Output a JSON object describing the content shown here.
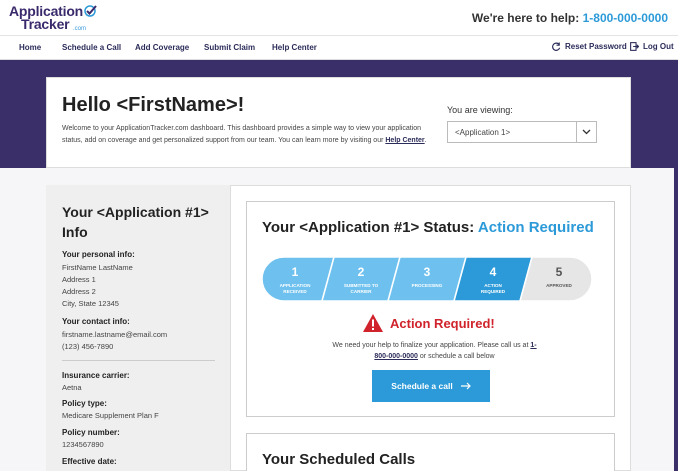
{
  "header": {
    "logo_line1": "Application",
    "logo_line2": "Tracker",
    "logo_suffix": ".com",
    "help_text": "We're here to help:",
    "help_phone": "1-800-000-0000"
  },
  "nav": {
    "items": [
      {
        "label": "Home"
      },
      {
        "label": "Schedule a Call"
      },
      {
        "label": "Add Coverage"
      },
      {
        "label": "Submit Claim"
      },
      {
        "label": "Help Center"
      }
    ],
    "reset_password": "Reset Password",
    "logout": "Log Out"
  },
  "hello": {
    "title": "Hello <FirstName>!",
    "text": "Welcome to your ApplicationTracker.com dashboard. This dashboard provides a simple way to view your application status, add on coverage and get personalized support from our team. You can learn more by visiting our",
    "link": "Help Center",
    "text_end": ".",
    "viewing_label": "You are viewing:",
    "selected_application": "<Application 1>"
  },
  "info": {
    "title": "Your <Application #1> Info",
    "personal_label": "Your personal info:",
    "personal_lines": [
      "FirstName LastName",
      "Address 1",
      "Address 2",
      "City, State 12345"
    ],
    "contact_label": "Your contact info:",
    "contact_lines": [
      "firstname.lastname@email.com",
      "(123) 456-7890"
    ],
    "carrier_label": "Insurance carrier:",
    "carrier_value": "Aetna",
    "policy_type_label": "Policy type:",
    "policy_type_value": "Medicare Supplement Plan F",
    "policy_number_label": "Policy number:",
    "policy_number_value": "1234567890",
    "effective_label": "Effective date:"
  },
  "status": {
    "title_prefix": "Your <Application #1> Status:",
    "title_status": "Action Required",
    "steps": [
      {
        "num": "1",
        "label": [
          "APPLICATION",
          "RECEIVED"
        ]
      },
      {
        "num": "2",
        "label": [
          "SUBMITTED TO",
          "CARRIER"
        ]
      },
      {
        "num": "3",
        "label": [
          "PROCESSING"
        ]
      },
      {
        "num": "4",
        "label": [
          "ACTION",
          "REQUIRED"
        ]
      },
      {
        "num": "5",
        "label": [
          "APPROVED"
        ]
      }
    ],
    "active_step": 4,
    "alert_title": "Action Required!",
    "alert_message": "We need your help to finalize your application. Please call us at",
    "alert_phone": "1-800-000-0000",
    "alert_message_end": "or schedule a call below",
    "button_label": "Schedule a call"
  },
  "calls": {
    "title": "Your Scheduled Calls"
  },
  "colors": {
    "brand_purple": "#3b2f6a",
    "accent_blue": "#2c9ad8",
    "alert_red": "#d0232c"
  }
}
